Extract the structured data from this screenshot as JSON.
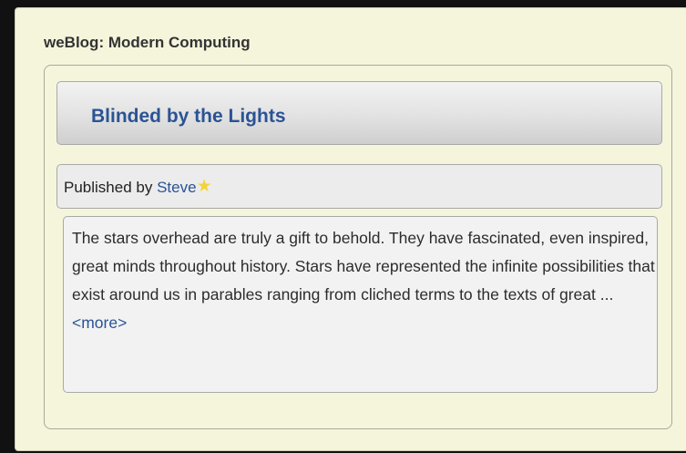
{
  "blog": {
    "title": "weBlog: Modern Computing"
  },
  "post": {
    "title": "Blinded by the Lights",
    "published_by_label": "Published by",
    "author": "Steve",
    "author_icon": "star-icon",
    "excerpt": "The stars overhead are truly a gift to behold. They have fascinated, even inspired, great minds throughout history. Stars have represented the infinite possibilities that exist around us in parables ranging from cliched terms to the texts of great ...",
    "more_label": "<more>"
  },
  "colors": {
    "page_background": "#111111",
    "panel_background": "#f5f5dc",
    "link": "#2a5394",
    "star": "#f3d23c"
  }
}
